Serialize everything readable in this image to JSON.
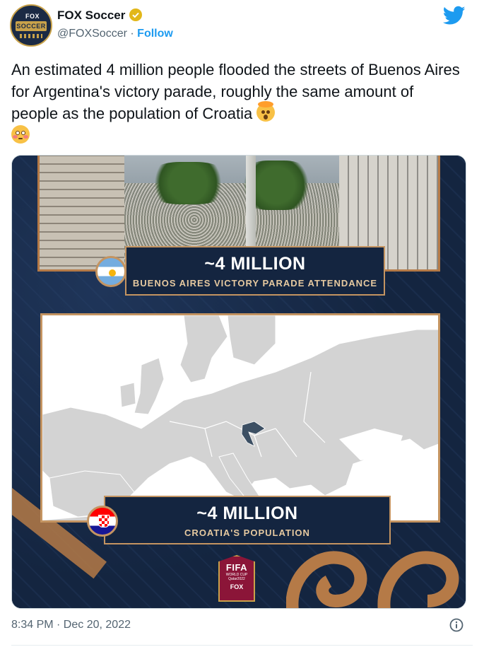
{
  "author": {
    "name": "FOX Soccer",
    "handle": "@FOXSoccer",
    "separator": "·",
    "follow_label": "Follow",
    "avatar_text_top": "FOX",
    "avatar_text_main": "SOCCER",
    "verified_color": "#e2b719"
  },
  "tweet": {
    "text": "An estimated 4 million people flooded the streets of Buenos Aires for Argentina's victory parade, roughly the same amount of people as the population of Croatia",
    "emojis": [
      "exploding-head-emoji",
      "flushed-face-emoji"
    ]
  },
  "media": {
    "stat_top": {
      "number": "~4 MILLION",
      "label": "BUENOS AIRES VICTORY PARADE ATTENDANCE"
    },
    "stat_bottom": {
      "number": "~4 MILLION",
      "label": "CROATIA'S POPULATION"
    },
    "badge": {
      "line1": "FIFA",
      "line2": "WORLD CUP",
      "line3": "Qatar2022",
      "line4": "FOX"
    },
    "colors": {
      "navy": "#142540",
      "gold": "#c49461",
      "highlight": "#3c4f63"
    }
  },
  "footer": {
    "timestamp": "8:34 PM · Dec 20, 2022"
  },
  "icons": {
    "brand": "twitter-bird-icon",
    "info": "info-icon",
    "accent": "#1d9bf0"
  }
}
